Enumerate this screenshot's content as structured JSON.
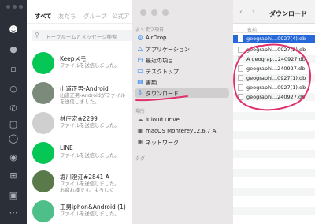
{
  "line": {
    "tabs": [
      "すべて",
      "友だち",
      "グループ",
      "公式ア"
    ],
    "search_placeholder": "トークルームとメッセージ検索",
    "chats": [
      {
        "name": "Keepメモ",
        "sub": "ファイルを送信しました。",
        "avatar_color": "#06c755"
      },
      {
        "name": "山道正男-Android",
        "sub": "山道正男-Androidがファイル\nを送信しました。",
        "avatar_color": "#7b8a7a"
      },
      {
        "name": "林庄宏❀2299",
        "sub": "ファイルを送信しました。",
        "avatar_color": "#cfcfcf"
      },
      {
        "name": "LINE",
        "sub": "ファイルを送信しました。",
        "avatar_color": "#06c755"
      },
      {
        "name": "堀川澄江#2841 A",
        "sub": "ファイルを送信しました。\nお疲れ様です。よろしく",
        "avatar_color": "#5a7a4a"
      },
      {
        "name": "正男iphon&Android (1)",
        "sub": "ファイルを送信しました。",
        "avatar_color": "#4fbf8a"
      }
    ]
  },
  "finder": {
    "sidebar": {
      "favorites_header": "よく使う項目",
      "favorites": [
        {
          "label": "AirDrop",
          "icon": "airdrop-icon"
        },
        {
          "label": "アプリケーション",
          "icon": "applications-icon"
        },
        {
          "label": "最近の項目",
          "icon": "recents-icon"
        },
        {
          "label": "デスクトップ",
          "icon": "desktop-icon"
        },
        {
          "label": "書類",
          "icon": "document-icon"
        },
        {
          "label": "ダウンロード",
          "icon": "download-icon"
        }
      ],
      "locations_header": "場所",
      "locations": [
        {
          "label": "iCloud Drive",
          "icon": "cloud-icon"
        },
        {
          "label": "macOS Monterey12.6.7 A",
          "icon": "disk-icon"
        },
        {
          "label": "ネットワーク",
          "icon": "network-icon"
        }
      ],
      "tags_header": "タグ"
    },
    "toolbar": {
      "back": "‹",
      "forward": "›",
      "title": "ダウンロード"
    },
    "column_header": "名前",
    "files": [
      "geographi...0927(4).db",
      "geographi...0927(2).db",
      "A geograp...240927.db",
      "geographi...240927.db",
      "geographi...0927(1).db",
      "geographi...0927(1).db",
      "geographi...240927.db"
    ],
    "selected_index": 0,
    "annotation_color": "#e0306e"
  }
}
